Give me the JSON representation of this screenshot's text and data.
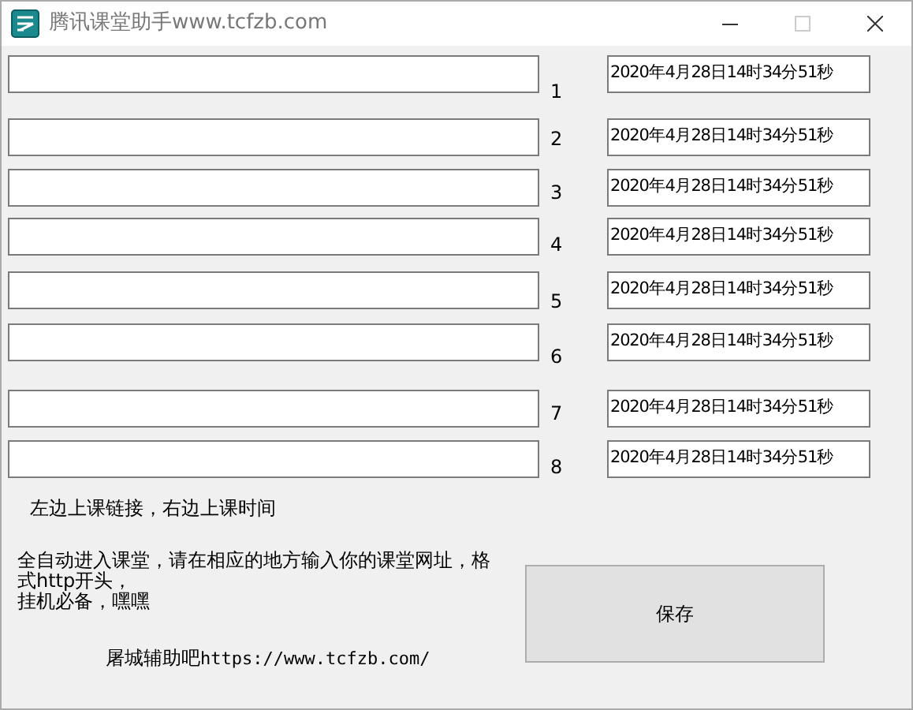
{
  "window": {
    "title": "腾讯课堂助手www.tcfzb.com"
  },
  "rows": [
    {
      "number": "1",
      "time": "2020年4月28日14时34分51秒"
    },
    {
      "number": "2",
      "time": "2020年4月28日14时34分51秒"
    },
    {
      "number": "3",
      "time": "2020年4月28日14时34分51秒"
    },
    {
      "number": "4",
      "time": "2020年4月28日14时34分51秒"
    },
    {
      "number": "5",
      "time": "2020年4月28日14时34分51秒"
    },
    {
      "number": "6",
      "time": "2020年4月28日14时34分51秒"
    },
    {
      "number": "7",
      "time": "2020年4月28日14时34分51秒"
    },
    {
      "number": "8",
      "time": "2020年4月28日14时34分51秒"
    }
  ],
  "hint": "左边上课链接，右边上课时间",
  "description": [
    "全自动进入课堂，请在相应的地方输入你的课堂网址，格式http开头，",
    "挂机必备，嘿嘿"
  ],
  "footer": {
    "site": "屠城辅助吧",
    "url": "https://www.tcfzb.com/"
  },
  "save_button": "保存"
}
